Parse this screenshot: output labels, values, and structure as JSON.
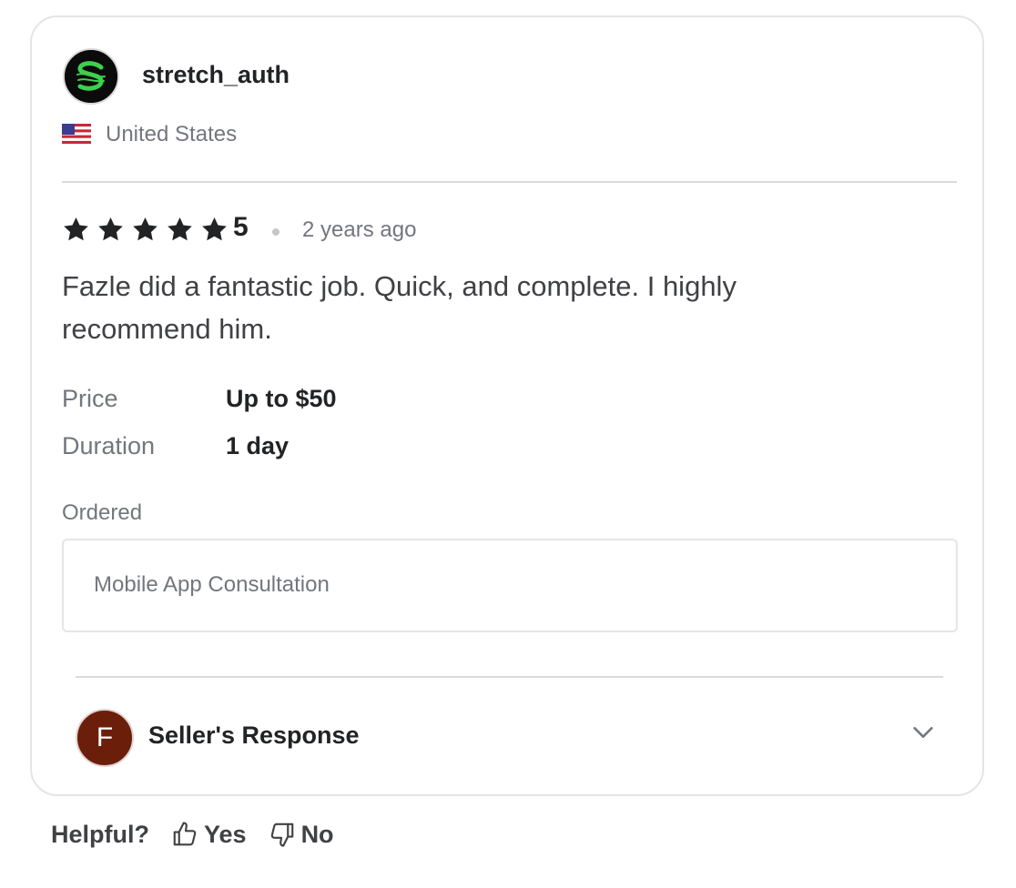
{
  "reviewer": {
    "username": "stretch_auth",
    "avatar_icon": "green-swirl-logo-icon",
    "country": "United States",
    "flag_icon": "us-flag-icon"
  },
  "rating": {
    "stars": 5,
    "value": "5",
    "time_ago": "2 years ago"
  },
  "review_text": "Fazle did a fantastic job. Quick, and complete. I highly recommend him.",
  "details": {
    "price_label": "Price",
    "price_value": "Up to $50",
    "duration_label": "Duration",
    "duration_value": "1 day"
  },
  "ordered": {
    "label": "Ordered",
    "item": "Mobile App Consultation"
  },
  "seller_response": {
    "avatar_letter": "F",
    "avatar_color": "#6b1f0b",
    "title": "Seller's Response",
    "expand_icon": "chevron-down-icon"
  },
  "helpful": {
    "label": "Helpful?",
    "yes_label": "Yes",
    "no_label": "No",
    "yes_icon": "thumbs-up-icon",
    "no_icon": "thumbs-down-icon"
  }
}
